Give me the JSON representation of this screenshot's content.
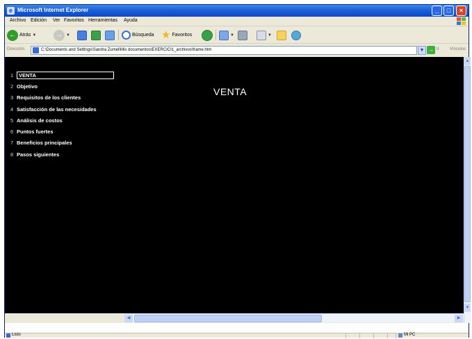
{
  "window": {
    "title": "Microsoft Internet Explorer",
    "minimize_glyph": "_",
    "maximize_glyph": "□",
    "close_glyph": "×"
  },
  "menubar": {
    "items": [
      "Archivo",
      "Edición",
      "Ver",
      "Favoritos",
      "Herramientas",
      "Ayuda"
    ]
  },
  "toolbar": {
    "back_label": "Atrás",
    "search_label": "Búsqueda",
    "favorites_label": "Favoritos"
  },
  "addressbar": {
    "label": "Dirección",
    "url": "C:\\Documents and Settings\\Sandra Zumel\\Mis documentos\\EXERCICI1_archivos\\frame.htm",
    "go_label": "Ir",
    "links_label": "Vínculos"
  },
  "navigation": {
    "items": [
      {
        "number": "1",
        "label": "VENTA"
      },
      {
        "number": "2",
        "label": "Objetivo"
      },
      {
        "number": "3",
        "label": "Requisitos de los clientes"
      },
      {
        "number": "4",
        "label": "Satisfacción de las necesidades"
      },
      {
        "number": "5",
        "label": "Análisis de costos"
      },
      {
        "number": "6",
        "label": "Puntos fuertes"
      },
      {
        "number": "7",
        "label": "Beneficios principales"
      },
      {
        "number": "8",
        "label": "Pasos siguientes"
      }
    ],
    "selected_index": 0
  },
  "slide": {
    "title": "VENTA"
  },
  "statusbar": {
    "status": "Listo",
    "zone": "Mi PC"
  },
  "colors": {
    "titlebar": "#0b47c9",
    "content_background": "#000000",
    "text": "#ffffff"
  }
}
